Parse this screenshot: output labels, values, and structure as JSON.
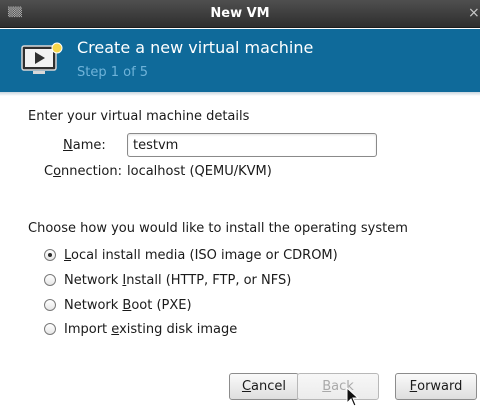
{
  "window": {
    "title": "New VM",
    "menu_glyph": "▒▒",
    "close_glyph": "×"
  },
  "banner": {
    "heading": "Create a new virtual machine",
    "step": "Step 1 of 5",
    "icon": "monitor-play-icon",
    "color": "#0f6a9a"
  },
  "details": {
    "section_title": "Enter your virtual machine details",
    "name_label_pre": "",
    "name_label_accel": "N",
    "name_label_post": "ame:",
    "name_value": "testvm",
    "connection_label_pre": "C",
    "connection_label_accel": "o",
    "connection_label_post": "nnection:",
    "connection_value": "localhost (QEMU/KVM)"
  },
  "install": {
    "section_title": "Choose how you would like to install the operating system",
    "options": [
      {
        "pre": "",
        "accel": "L",
        "post": "ocal install media (ISO image or CDROM)",
        "checked": true
      },
      {
        "pre": "Network ",
        "accel": "I",
        "post": "nstall (HTTP, FTP, or NFS)",
        "checked": false
      },
      {
        "pre": "Network ",
        "accel": "B",
        "post": "oot (PXE)",
        "checked": false
      },
      {
        "pre": "Import ",
        "accel": "e",
        "post": "xisting disk image",
        "checked": false
      }
    ]
  },
  "buttons": {
    "cancel_pre": "",
    "cancel_accel": "C",
    "cancel_post": "ancel",
    "back_pre": "",
    "back_accel": "B",
    "back_post": "ack",
    "forward_pre": "",
    "forward_accel": "F",
    "forward_post": "orward",
    "back_enabled": false
  }
}
